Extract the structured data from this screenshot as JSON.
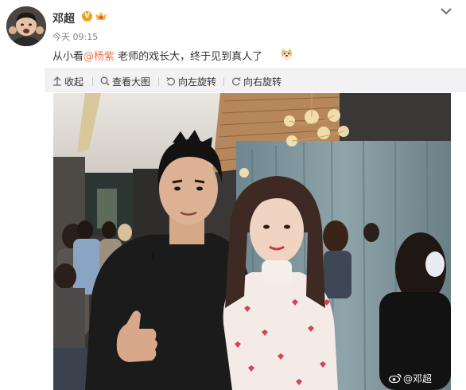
{
  "post": {
    "author": "邓超",
    "verified_badge": "V",
    "member_badge_icon": "member-crown-icon",
    "time": "今天 09:15",
    "text_before": "从小看",
    "mention": "@杨紫",
    "text_after": " 老师的戏长大，终于见到真人了",
    "emoji_icon": "doge-emoji-icon"
  },
  "toolbar": {
    "collapse": "收起",
    "view_large": "查看大图",
    "rotate_left": "向左旋转",
    "rotate_right": "向右旋转"
  },
  "photo": {
    "watermark": "@邓超"
  },
  "colors": {
    "mention": "#eb7350",
    "toolbar_bg": "#f2f2f5",
    "vip_orange": "#f1a11c"
  }
}
